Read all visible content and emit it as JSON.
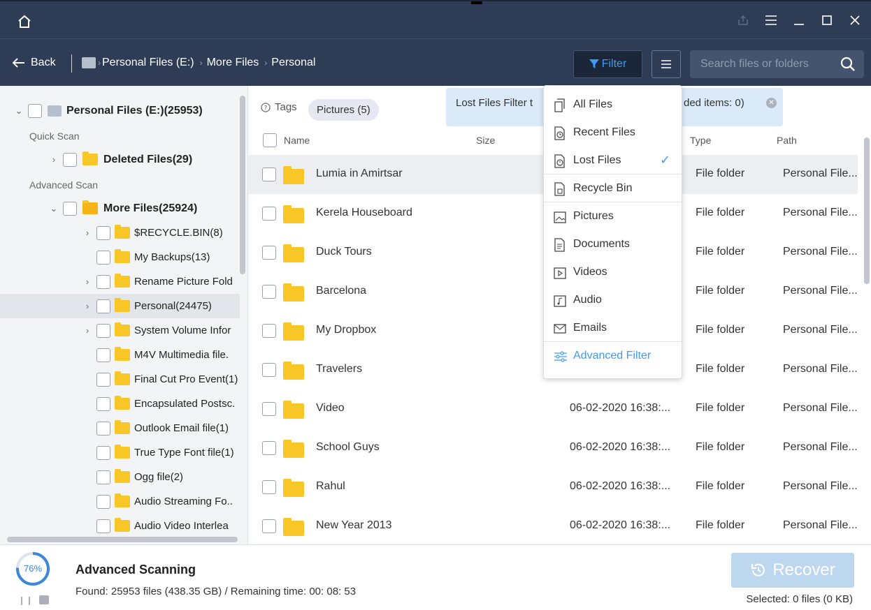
{
  "nav": {
    "back_label": "Back",
    "breadcrumbs": [
      "Personal Files (E:)",
      "More Files",
      "Personal"
    ],
    "filter_label": "Filter",
    "search_placeholder": "Search files or folders"
  },
  "tree": {
    "root_label": "Personal Files (E:)(25953)",
    "quick_scan_label": "Quick Scan",
    "deleted_label": "Deleted Files(29)",
    "advanced_scan_label": "Advanced Scan",
    "more_files_label": "More Files(25924)",
    "items": [
      {
        "label": "$RECYCLE.BIN(8)"
      },
      {
        "label": "My Backups(13)"
      },
      {
        "label": "Rename Picture Fold"
      },
      {
        "label": "Personal(24475)"
      },
      {
        "label": "System Volume Infor"
      },
      {
        "label": "M4V Multimedia file."
      },
      {
        "label": "Final Cut Pro Event(1)"
      },
      {
        "label": "Encapsulated Postsc."
      },
      {
        "label": "Outlook Email file(1)"
      },
      {
        "label": "True Type Font file(1)"
      },
      {
        "label": "Ogg file(2)"
      },
      {
        "label": "Audio Streaming Fo.."
      },
      {
        "label": "Audio Video Interlea"
      }
    ]
  },
  "main": {
    "tags_label": "Tags",
    "tag_chip": "Pictures (5)",
    "banner_left": "Lost Files Filter t",
    "banner_right": "ded items: 0)",
    "columns": {
      "name": "Name",
      "size": "Size",
      "type": "Type",
      "path": "Path"
    },
    "rows": [
      {
        "name": "Lumia in Amirtsar",
        "date": "",
        "type": "File folder",
        "path": "Personal File..."
      },
      {
        "name": "Kerela Houseboard",
        "date": "",
        "type": "File folder",
        "path": "Personal File..."
      },
      {
        "name": "Duck Tours",
        "date": "",
        "type": "File folder",
        "path": "Personal File..."
      },
      {
        "name": "Barcelona",
        "date": "",
        "type": "File folder",
        "path": "Personal File..."
      },
      {
        "name": "My Dropbox",
        "date": "",
        "type": "File folder",
        "path": "Personal File..."
      },
      {
        "name": "Travelers",
        "date": "",
        "type": "File folder",
        "path": "Personal File..."
      },
      {
        "name": "Video",
        "date": "06-02-2020 16:38:...",
        "type": "File folder",
        "path": "Personal File..."
      },
      {
        "name": "School Guys",
        "date": "06-02-2020 16:38:...",
        "type": "File folder",
        "path": "Personal File..."
      },
      {
        "name": "Rahul",
        "date": "06-02-2020 16:38:...",
        "type": "File folder",
        "path": "Personal File..."
      },
      {
        "name": "New Year 2013",
        "date": "06-02-2020 16:38:...",
        "type": "File folder",
        "path": "Personal File..."
      }
    ]
  },
  "filter_menu": {
    "items": [
      {
        "label": "All Files",
        "icon": "all-files-icon"
      },
      {
        "label": "Recent Files",
        "icon": "recent-files-icon"
      },
      {
        "label": "Lost Files",
        "icon": "lost-files-icon",
        "checked": true
      },
      {
        "label": "Recycle Bin",
        "icon": "recycle-bin-icon"
      },
      {
        "label": "Pictures",
        "icon": "pictures-icon"
      },
      {
        "label": "Documents",
        "icon": "documents-icon"
      },
      {
        "label": "Videos",
        "icon": "videos-icon"
      },
      {
        "label": "Audio",
        "icon": "audio-icon"
      },
      {
        "label": "Emails",
        "icon": "emails-icon"
      },
      {
        "label": "Advanced Filter",
        "icon": "advanced-filter-icon"
      }
    ]
  },
  "status": {
    "progress_label": "76%",
    "progress_value": 0.76,
    "title": "Advanced Scanning",
    "info": "Found: 25953 files (438.35 GB) / Remaining time: 00: 08: 53",
    "recover_label": "Recover",
    "selected": "Selected: 0 files (0 KB)"
  },
  "colors": {
    "header_bg": "#2e3c55",
    "accent": "#3e9bf5",
    "folder": "#f9c628",
    "recover_disabled": "#bdd7ef"
  }
}
